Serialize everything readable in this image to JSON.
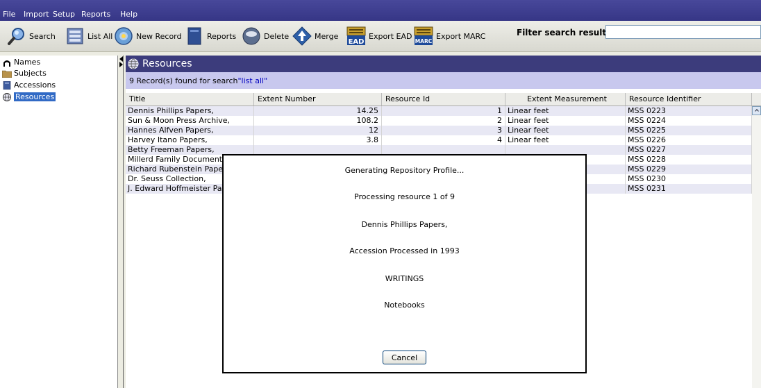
{
  "menu": [
    "File",
    "Import",
    "Setup",
    "Reports",
    "Help"
  ],
  "toolbar": {
    "search": "Search",
    "list_all": "List All",
    "new_record": "New Record",
    "reports": "Reports",
    "delete": "Delete",
    "merge": "Merge",
    "export_ead": "Export EAD",
    "export_marc": "Export MARC",
    "ead_badge": "EAD",
    "marc_badge": "MARC"
  },
  "filter": {
    "label": "Filter search results",
    "value": ""
  },
  "sidebar": {
    "items": [
      {
        "label": "Names",
        "icon": "names-icon"
      },
      {
        "label": "Subjects",
        "icon": "folder-icon"
      },
      {
        "label": "Accessions",
        "icon": "book-icon"
      },
      {
        "label": "Resources",
        "icon": "globe-icon",
        "selected": true
      }
    ]
  },
  "main": {
    "title": "Resources",
    "count_text": "9 Record(s) found for search ",
    "count_query": "\"list all\"",
    "columns": [
      "Title",
      "Extent Number",
      "Resource Id",
      "Extent Measurement",
      "Resource Identifier"
    ],
    "rows": [
      [
        "Dennis Phillips Papers,",
        "14.25",
        "1",
        "Linear feet",
        "MSS 0223"
      ],
      [
        "Sun & Moon Press Archive,",
        "108.2",
        "2",
        "Linear feet",
        "MSS 0224"
      ],
      [
        "Hannes Alfven Papers,",
        "12",
        "3",
        "Linear feet",
        "MSS 0225"
      ],
      [
        "Harvey Itano Papers,",
        "3.8",
        "4",
        "Linear feet",
        "MSS 0226"
      ],
      [
        "Betty Freeman Papers,",
        "",
        "",
        "",
        "MSS 0227"
      ],
      [
        "Millerd Family Documents,",
        "",
        "",
        "",
        "MSS 0228"
      ],
      [
        "Richard Rubenstein Papers",
        "",
        "",
        "",
        "MSS 0229"
      ],
      [
        "Dr. Seuss Collection,",
        "",
        "",
        "",
        "MSS 0230"
      ],
      [
        "J. Edward Hoffmeister Pap",
        "",
        "",
        "",
        "MSS 0231"
      ]
    ]
  },
  "dialog": {
    "lines": [
      "Generating Repository Profile...",
      "Processing resource 1 of 9",
      "Dennis Phillips Papers,",
      "Accession Processed in 1993",
      "WRITINGS",
      "Notebooks"
    ],
    "cancel": "Cancel"
  }
}
